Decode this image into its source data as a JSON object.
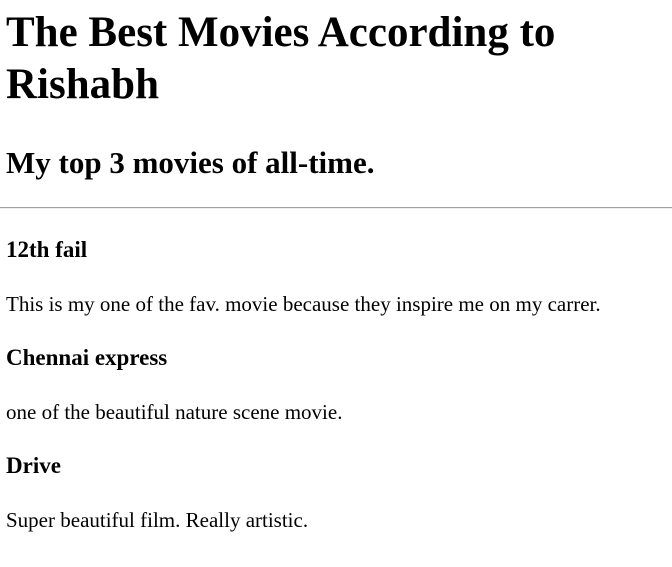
{
  "page": {
    "title": "The Best Movies According to Rishabh",
    "subtitle": "My top 3 movies of all-time."
  },
  "movies": [
    {
      "name": "12th fail",
      "description": "This is my one of the fav. movie because they inspire me on my carrer."
    },
    {
      "name": "Chennai express",
      "description": "one of the beautiful nature scene movie."
    },
    {
      "name": "Drive",
      "description": "Super beautiful film. Really artistic."
    }
  ]
}
